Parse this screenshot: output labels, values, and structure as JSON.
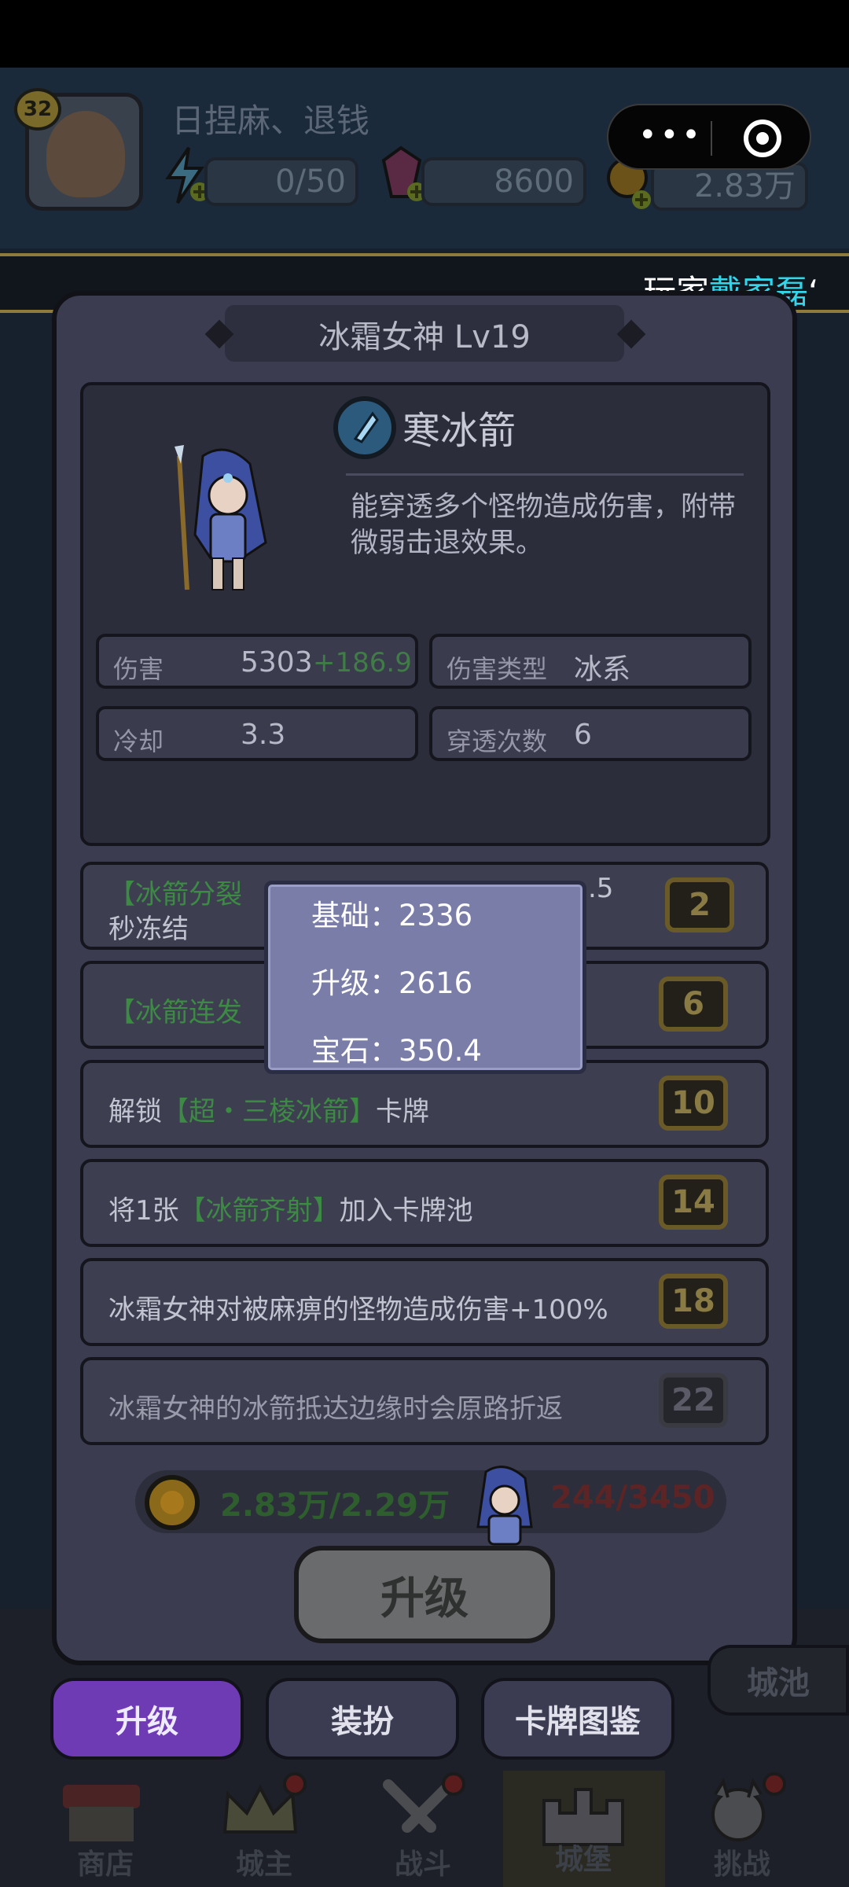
{
  "header": {
    "player_level": "32",
    "player_name": "日捏麻、退钱",
    "energy": "0/50",
    "gems": "8600",
    "gold": "2.83万"
  },
  "marquee": {
    "prefix": "玩家",
    "name": "戴家磊",
    "suffix": "‘"
  },
  "modal": {
    "title": "冰霜女神  Lv19",
    "skill_name": "寒冰箭",
    "skill_desc": "能穿透多个怪物造成伤害，附带微弱击退效果。",
    "stats": {
      "damage_label": "伤害",
      "damage_value": "5303",
      "damage_bonus": "+186.9",
      "damage_type_label": "伤害类型",
      "damage_type_value": "冰系",
      "cooldown_label": "冷却",
      "cooldown_value": "3.3",
      "pierce_label": "穿透次数",
      "pierce_value": "6"
    },
    "unlocks": [
      {
        "part1": "【冰箭分裂",
        "part2": ".5",
        "line2": "秒冻结",
        "level": "2"
      },
      {
        "part1": "【冰箭连发",
        "level": "6"
      },
      {
        "pre": "解锁",
        "green": "【超・三棱冰箭】",
        "post": "卡牌",
        "level": "10"
      },
      {
        "pre": "将1张",
        "green": "【冰箭齐射】",
        "post": "加入卡牌池",
        "level": "14"
      },
      {
        "text": "冰霜女神对被麻痹的怪物造成伤害+100%",
        "level": "18"
      },
      {
        "text": "冰霜女神的冰箭抵达边缘时会原路折返",
        "level": "22"
      }
    ],
    "gold_cost": "2.83万/2.29万",
    "shard_cost": "244/3450",
    "upgrade_label": "升级"
  },
  "popup": {
    "base": "基础：2336",
    "upgrade": "升级：2616",
    "gem": "宝石：350.4"
  },
  "tabs": [
    "升级",
    "装扮",
    "卡牌图鉴"
  ],
  "bg_tab_right": "城池",
  "nav": [
    "商店",
    "城主",
    "战斗",
    "城堡",
    "挑战"
  ],
  "colors": {
    "accent_purple": "#6f3bb4",
    "highlight_cyan": "#32d6e8",
    "unlock_green": "#3c8a44"
  }
}
